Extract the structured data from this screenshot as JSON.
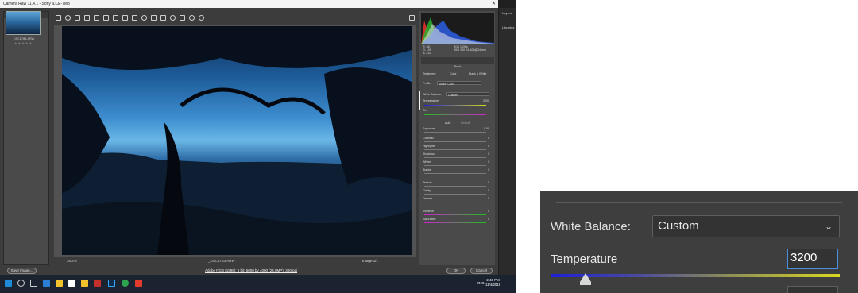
{
  "window": {
    "title": "Camera Raw 11.4.1 - Sony ILCE-7M3",
    "close_glyph": "✕"
  },
  "ps_panels": {
    "items": [
      "Layers",
      "Libraries"
    ]
  },
  "filmstrip": {
    "header": "Filmstrip",
    "thumb_name": "_DSC8783.ARW",
    "stars": "★ ★ ★ ★ ★"
  },
  "status": {
    "zoom": "26.2%",
    "filename": "_DSC8783.ARW",
    "image_count": "Image 1/1"
  },
  "bottom": {
    "save_label": "Save Image...",
    "workflow_link": "Adobe RGB (1998); 8 bit; 6000 by 4000 (24.0MP); 300 ppi",
    "ok_label": "OK",
    "cancel_label": "Cancel"
  },
  "histogram": {
    "r_label": "R:",
    "r_value": "48",
    "g_label": "G:",
    "g_value": "109",
    "b_label": "B:",
    "b_value": "212",
    "cam1": "f/16   1/25 s",
    "cam2": "ISO 200   24-105@24 mm"
  },
  "basic": {
    "panel_title": "Basic",
    "treatment_label": "Treatment:",
    "treatment_color": "Color",
    "treatment_bw": "Black & White",
    "profile_label": "Profile:",
    "profile_value": "Adobe Color",
    "wb_label": "White Balance:",
    "wb_value": "Custom",
    "temp_label": "Temperature",
    "temp_value": "3200",
    "tint_label": "Tint",
    "auto_label": "Auto",
    "default_label": "Default",
    "sliders": [
      {
        "label": "Exposure",
        "value": "0.00"
      },
      {
        "label": "Contrast",
        "value": "0"
      },
      {
        "label": "Highlights",
        "value": "0"
      },
      {
        "label": "Shadows",
        "value": "0"
      },
      {
        "label": "Whites",
        "value": "0"
      },
      {
        "label": "Blacks",
        "value": "0"
      },
      {
        "label": "Texture",
        "value": "0"
      },
      {
        "label": "Clarity",
        "value": "0"
      },
      {
        "label": "Dehaze",
        "value": "0"
      },
      {
        "label": "Vibrance",
        "value": "0"
      },
      {
        "label": "Saturation",
        "value": "0"
      }
    ]
  },
  "zoom": {
    "wb_label": "White Balance:",
    "wb_value": "Custom",
    "temp_label": "Temperature",
    "temp_value": "3200",
    "temp_slider_position_fraction": 0.12,
    "caret": "⌄"
  },
  "taskbar": {
    "time": "2:48 PM",
    "date": "11/4/2019",
    "lang": "ENG"
  },
  "colors": {
    "accent": "#4a8fdc",
    "bg": "#3e3e3e",
    "temp_cold": "#1f1fd8",
    "temp_warm": "#d8d820"
  }
}
